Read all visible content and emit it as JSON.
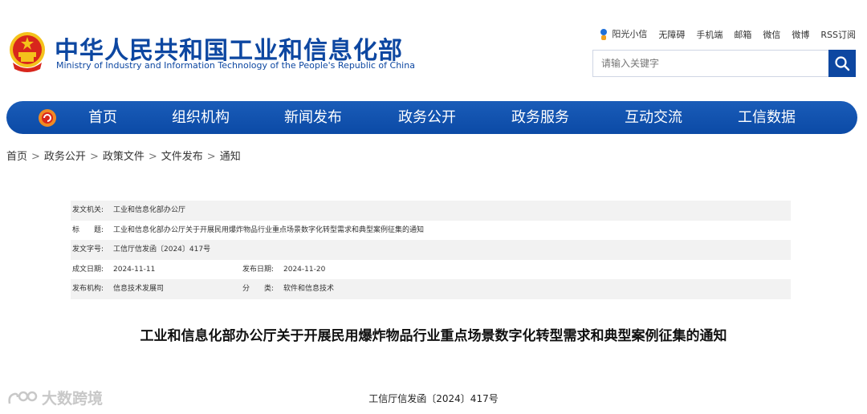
{
  "header": {
    "site_name_cn": "中华人民共和国工业和信息化部",
    "site_name_en": "Ministry of Industry and Information Technology of the People's Republic of China",
    "top_links": [
      "阳光小信",
      "无障碍",
      "手机端",
      "邮箱",
      "微信",
      "微博",
      "RSS订阅"
    ],
    "search_placeholder": "请输入关键字"
  },
  "nav": {
    "items": [
      "首页",
      "组织机构",
      "新闻发布",
      "政务公开",
      "政务服务",
      "互动交流",
      "工信数据"
    ]
  },
  "breadcrumb": [
    "首页",
    "政务公开",
    "政策文件",
    "文件发布",
    "通知"
  ],
  "breadcrumb_sep": ">",
  "meta": {
    "issuer_label": "发文机关:",
    "issuer": "工业和信息化部办公厅",
    "title_label": "标　　题:",
    "title": "工业和信息化部办公厅关于开展民用爆炸物品行业重点场景数字化转型需求和典型案例征集的通知",
    "doc_no_label": "发文字号:",
    "doc_no": "工信厅信发函〔2024〕417号",
    "written_label": "成文日期:",
    "written": "2024-11-11",
    "published_label": "发布日期:",
    "published": "2024-11-20",
    "org_label": "发布机构:",
    "org": "信息技术发展司",
    "category_label": "分　　类:",
    "category": "软件和信息技术"
  },
  "document": {
    "title": "工业和信息化部办公厅关于开展民用爆炸物品行业重点场景数字化转型需求和典型案例征集的通知",
    "number": "工信厅信发函〔2024〕417号"
  },
  "watermark": {
    "text": "大数跨境"
  },
  "colors": {
    "brand_blue": "#0d47a1",
    "nav_blue": "#1257b3",
    "emblem_red": "#d8261c",
    "emblem_gold": "#f4c21b"
  }
}
